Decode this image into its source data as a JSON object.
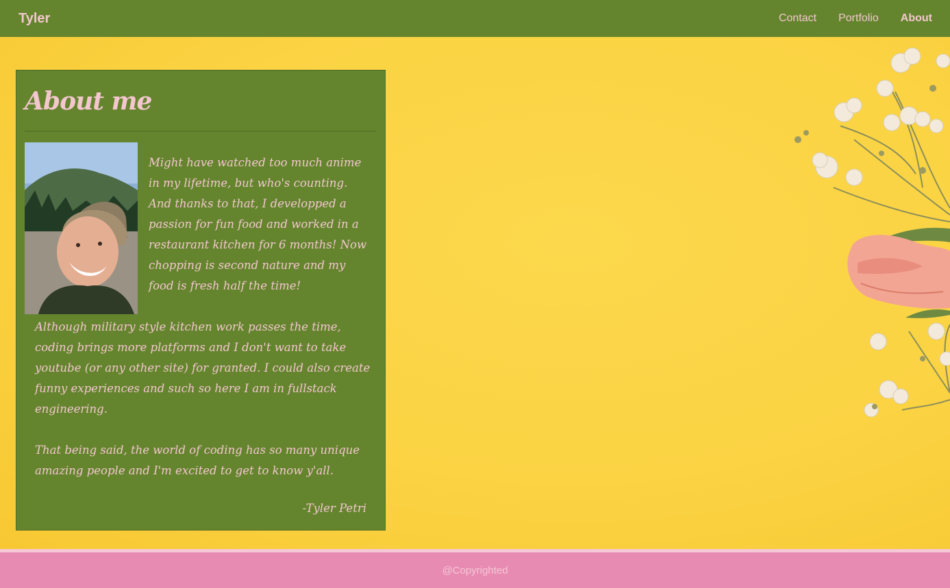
{
  "nav": {
    "brand": "Tyler",
    "links": [
      {
        "label": "Contact",
        "active": false
      },
      {
        "label": "Portfolio",
        "active": false
      },
      {
        "label": "About",
        "active": true
      }
    ]
  },
  "about": {
    "title": "About me",
    "paragraphs": [
      "Might have watched too much anime in my lifetime, but who's counting. And thanks to that, I developped a passion for fun food and worked in a restaurant kitchen for 6 months! Now chopping is second nature and my food is fresh half the time!",
      "Although military style kitchen work passes the time, coding brings more platforms and I don't want to take youtube (or any other site) for granted. I could also create funny experiences and such so here I am in fullstack engineering.",
      "That being said, the world of coding has so many unique amazing people and I'm excited to get to know y'all."
    ],
    "signature": "-Tyler Petri"
  },
  "footer": {
    "copyright": "@Copyrighted"
  },
  "colors": {
    "nav_bg": "#64852e",
    "accent_pink": "#f4c6cf",
    "background_yellow": "#fbd443",
    "footer_pink": "#e78bb3"
  }
}
